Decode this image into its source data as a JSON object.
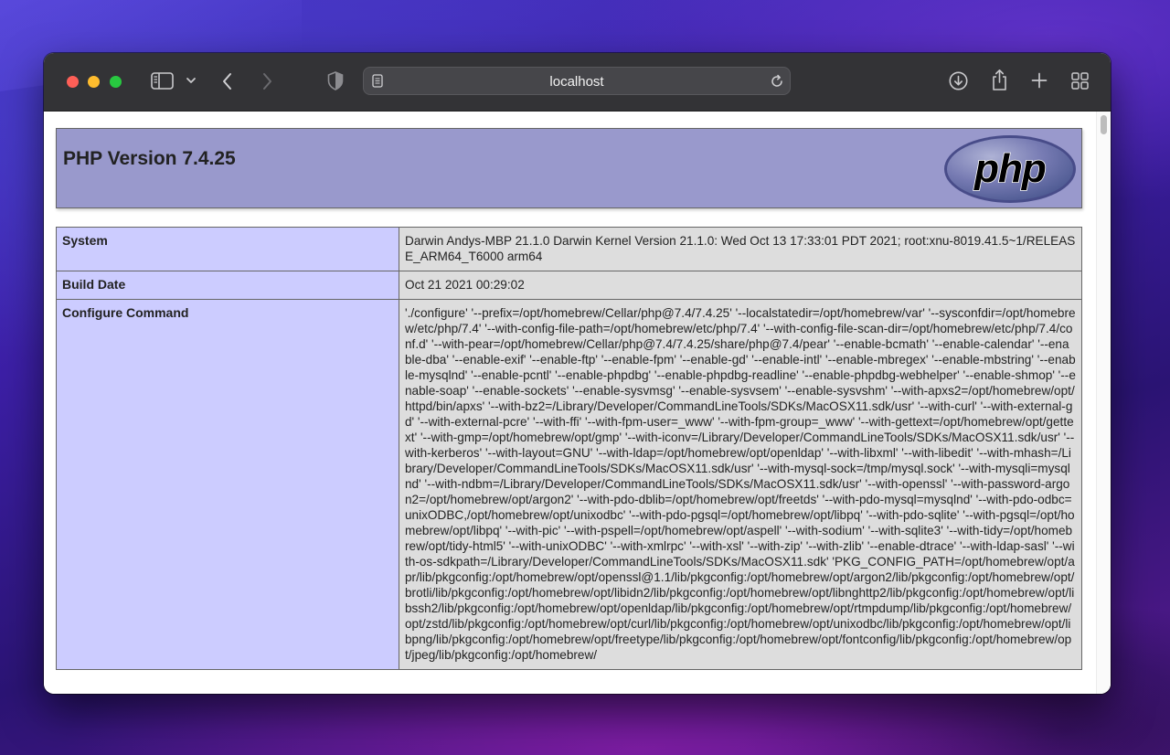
{
  "browser": {
    "address": "localhost"
  },
  "page": {
    "header_title": "PHP Version 7.4.25",
    "logo_text": "php",
    "rows": [
      {
        "key": "System",
        "value": "Darwin Andys-MBP 21.1.0 Darwin Kernel Version 21.1.0: Wed Oct 13 17:33:01 PDT 2021; root:xnu-8019.41.5~1/RELEASE_ARM64_T6000 arm64"
      },
      {
        "key": "Build Date",
        "value": "Oct 21 2021 00:29:02"
      },
      {
        "key": "Configure Command",
        "value": "'./configure' '--prefix=/opt/homebrew/Cellar/php@7.4/7.4.25' '--localstatedir=/opt/homebrew/var' '--sysconfdir=/opt/homebrew/etc/php/7.4' '--with-config-file-path=/opt/homebrew/etc/php/7.4' '--with-config-file-scan-dir=/opt/homebrew/etc/php/7.4/conf.d' '--with-pear=/opt/homebrew/Cellar/php@7.4/7.4.25/share/php@7.4/pear' '--enable-bcmath' '--enable-calendar' '--enable-dba' '--enable-exif' '--enable-ftp' '--enable-fpm' '--enable-gd' '--enable-intl' '--enable-mbregex' '--enable-mbstring' '--enable-mysqlnd' '--enable-pcntl' '--enable-phpdbg' '--enable-phpdbg-readline' '--enable-phpdbg-webhelper' '--enable-shmop' '--enable-soap' '--enable-sockets' '--enable-sysvmsg' '--enable-sysvsem' '--enable-sysvshm' '--with-apxs2=/opt/homebrew/opt/httpd/bin/apxs' '--with-bz2=/Library/Developer/CommandLineTools/SDKs/MacOSX11.sdk/usr' '--with-curl' '--with-external-gd' '--with-external-pcre' '--with-ffi' '--with-fpm-user=_www' '--with-fpm-group=_www' '--with-gettext=/opt/homebrew/opt/gettext' '--with-gmp=/opt/homebrew/opt/gmp' '--with-iconv=/Library/Developer/CommandLineTools/SDKs/MacOSX11.sdk/usr' '--with-kerberos' '--with-layout=GNU' '--with-ldap=/opt/homebrew/opt/openldap' '--with-libxml' '--with-libedit' '--with-mhash=/Library/Developer/CommandLineTools/SDKs/MacOSX11.sdk/usr' '--with-mysql-sock=/tmp/mysql.sock' '--with-mysqli=mysqlnd' '--with-ndbm=/Library/Developer/CommandLineTools/SDKs/MacOSX11.sdk/usr' '--with-openssl' '--with-password-argon2=/opt/homebrew/opt/argon2' '--with-pdo-dblib=/opt/homebrew/opt/freetds' '--with-pdo-mysql=mysqlnd' '--with-pdo-odbc=unixODBC,/opt/homebrew/opt/unixodbc' '--with-pdo-pgsql=/opt/homebrew/opt/libpq' '--with-pdo-sqlite' '--with-pgsql=/opt/homebrew/opt/libpq' '--with-pic' '--with-pspell=/opt/homebrew/opt/aspell' '--with-sodium' '--with-sqlite3' '--with-tidy=/opt/homebrew/opt/tidy-html5' '--with-unixODBC' '--with-xmlrpc' '--with-xsl' '--with-zip' '--with-zlib' '--enable-dtrace' '--with-ldap-sasl' '--with-os-sdkpath=/Library/Developer/CommandLineTools/SDKs/MacOSX11.sdk' 'PKG_CONFIG_PATH=/opt/homebrew/opt/apr/lib/pkgconfig:/opt/homebrew/opt/openssl@1.1/lib/pkgconfig:/opt/homebrew/opt/argon2/lib/pkgconfig:/opt/homebrew/opt/brotli/lib/pkgconfig:/opt/homebrew/opt/libidn2/lib/pkgconfig:/opt/homebrew/opt/libnghttp2/lib/pkgconfig:/opt/homebrew/opt/libssh2/lib/pkgconfig:/opt/homebrew/opt/openldap/lib/pkgconfig:/opt/homebrew/opt/rtmpdump/lib/pkgconfig:/opt/homebrew/opt/zstd/lib/pkgconfig:/opt/homebrew/opt/curl/lib/pkgconfig:/opt/homebrew/opt/unixodbc/lib/pkgconfig:/opt/homebrew/opt/libpng/lib/pkgconfig:/opt/homebrew/opt/freetype/lib/pkgconfig:/opt/homebrew/opt/fontconfig/lib/pkgconfig:/opt/homebrew/opt/jpeg/lib/pkgconfig:/opt/homebrew/"
      }
    ]
  },
  "colors": {
    "header_bg": "#9999cc",
    "key_bg": "#ccccff",
    "value_bg": "#dddddd",
    "toolbar_bg": "#333336"
  },
  "icons": {
    "sidebar": "sidebar-icon",
    "chevron": "chevron-down-icon",
    "back": "chevron-left-icon",
    "forward": "chevron-right-icon",
    "privacy": "shield-icon",
    "page": "page-icon",
    "reload": "reload-icon",
    "download": "download-icon",
    "share": "share-icon",
    "new_tab": "plus-icon",
    "tabs": "grid-icon"
  }
}
